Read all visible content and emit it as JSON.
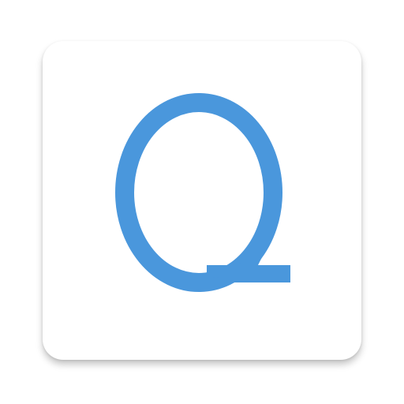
{
  "app_icon": {
    "letter": "Q",
    "letter_color": "#4a97dc",
    "tile_color": "#ffffff",
    "icon": "q-letter-icon"
  }
}
